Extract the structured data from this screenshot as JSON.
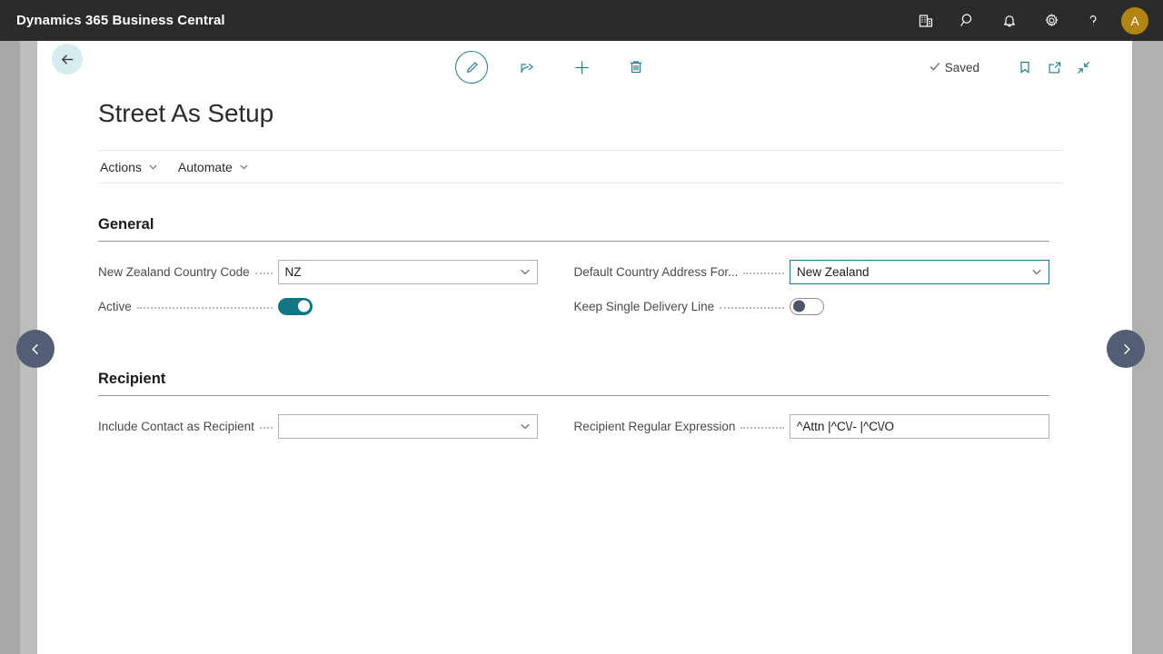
{
  "app": {
    "title": "Dynamics 365 Business Central",
    "header_icons": [
      {
        "name": "company-icon",
        "label": "Company"
      },
      {
        "name": "search-icon",
        "label": "Search"
      },
      {
        "name": "notification-bell-icon",
        "label": "Notifications"
      },
      {
        "name": "gear-icon",
        "label": "Settings"
      },
      {
        "name": "help-question-icon",
        "label": "Help"
      }
    ],
    "avatar": {
      "initial": "A",
      "color": "#b08512"
    }
  },
  "commandbar": {
    "back_label": "Back",
    "center_actions": [
      {
        "name": "edit-pencil-icon",
        "label": "Edit"
      },
      {
        "name": "share-icon",
        "label": "Share"
      },
      {
        "name": "new-plus-icon",
        "label": "New"
      },
      {
        "name": "delete-trash-icon",
        "label": "Delete"
      }
    ],
    "status": "Saved",
    "right_actions": [
      {
        "name": "bookmark-icon",
        "label": "Bookmark"
      },
      {
        "name": "open-in-new-window-icon",
        "label": "Open in new window"
      },
      {
        "name": "collapse-icon",
        "label": "Collapse"
      }
    ]
  },
  "page": {
    "title": "Street As Setup",
    "menus": [
      {
        "label": "Actions"
      },
      {
        "label": "Automate"
      }
    ]
  },
  "sections": [
    {
      "id": "general",
      "title": "General",
      "left_fields": [
        {
          "id": "new-zealand-country-code",
          "label": "New Zealand Country Code",
          "type": "dropdown",
          "value": "NZ",
          "focused": false
        },
        {
          "id": "active",
          "label": "Active",
          "type": "toggle",
          "value": "on"
        }
      ],
      "right_fields": [
        {
          "id": "default-country-address-format",
          "label": "Default Country Address For...",
          "type": "dropdown",
          "value": "New Zealand",
          "focused": true
        },
        {
          "id": "keep-single-delivery-line",
          "label": "Keep Single Delivery Line",
          "type": "toggle",
          "value": "off"
        }
      ]
    },
    {
      "id": "recipient",
      "title": "Recipient",
      "left_fields": [
        {
          "id": "include-contact-as-recipient",
          "label": "Include Contact as Recipient",
          "type": "dropdown",
          "value": "",
          "focused": false
        }
      ],
      "right_fields": [
        {
          "id": "recipient-regular-expression",
          "label": "Recipient Regular Expression",
          "type": "textbox",
          "value": "^Attn |^C\\/- |^C\\/O",
          "focused": false
        }
      ]
    }
  ],
  "navigation": {
    "previous_label": "Previous",
    "next_label": "Next"
  },
  "colors": {
    "accent_teal": "#1a7e88",
    "toggle_on": "#11767f",
    "topbar": "#2b2b2b",
    "avatar_gold": "#b08512",
    "nav_arrow": "#535e74"
  }
}
